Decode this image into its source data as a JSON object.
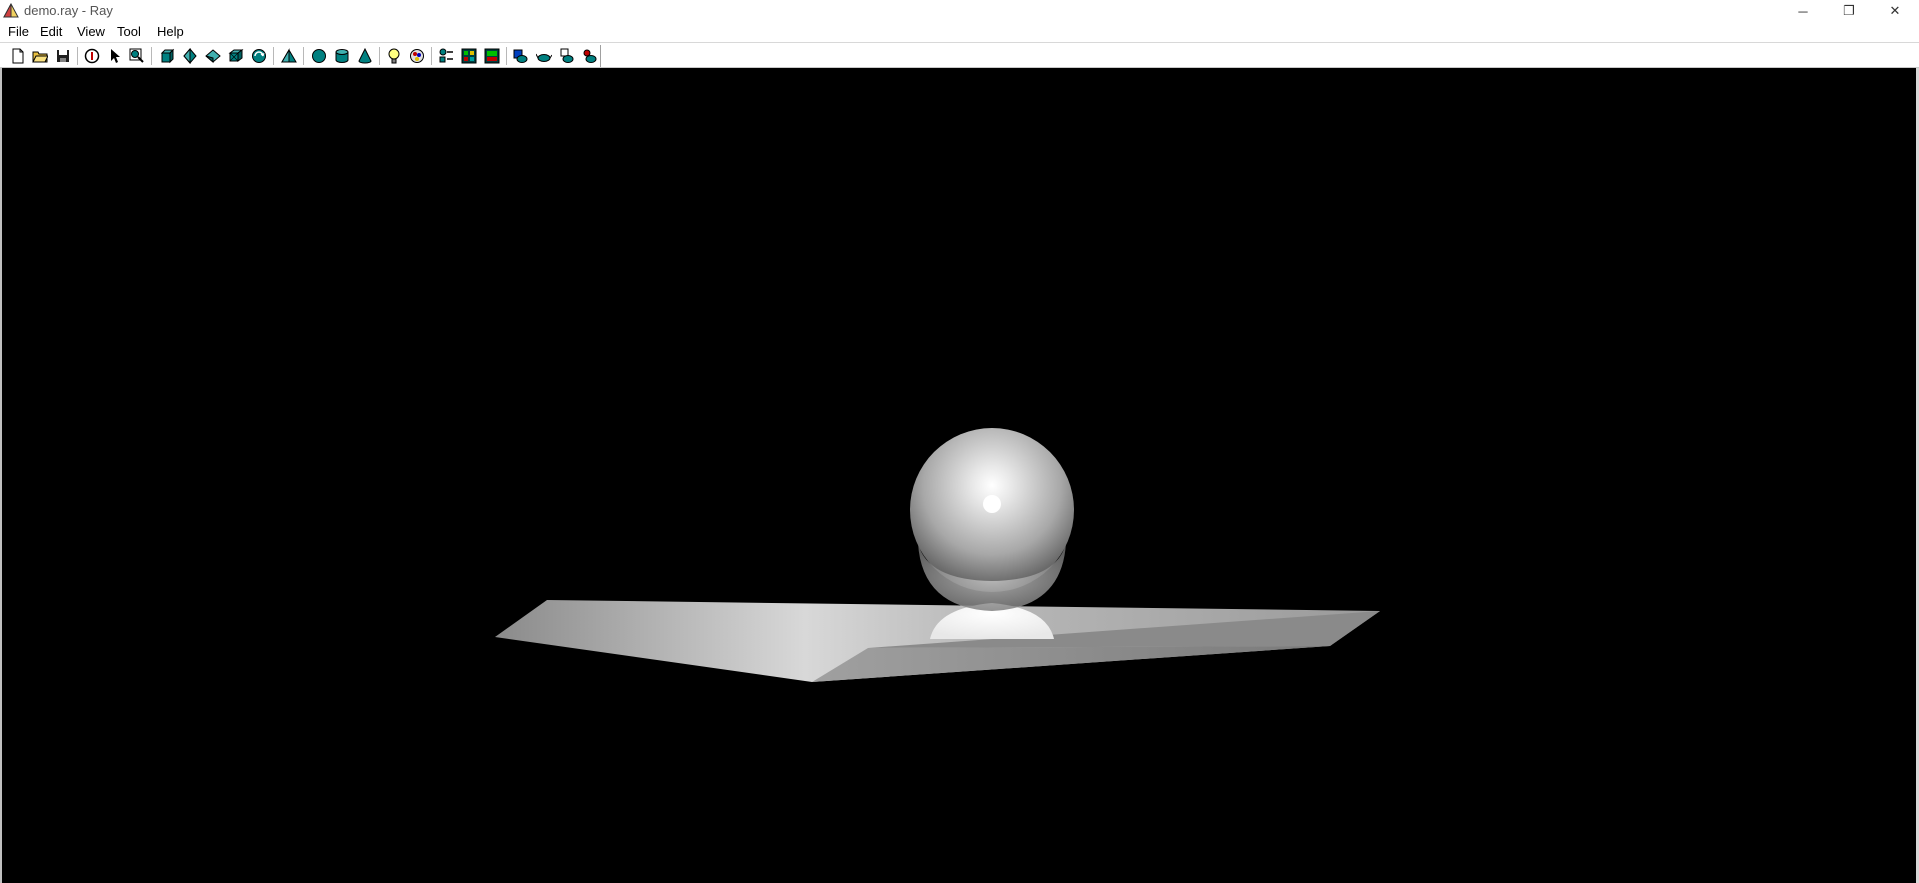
{
  "window": {
    "title": "demo.ray - Ray",
    "app_icon": "pyramid-icon",
    "controls": {
      "minimize": "─",
      "maximize": "❐",
      "close": "✕"
    }
  },
  "menu": {
    "items": [
      {
        "label": "File"
      },
      {
        "label": "Edit"
      },
      {
        "label": "View"
      },
      {
        "label": "Tool"
      },
      {
        "label": "Help"
      }
    ]
  },
  "toolbar": {
    "buttons": [
      {
        "icon": "new-file-icon"
      },
      {
        "icon": "open-folder-icon"
      },
      {
        "icon": "save-disk-icon"
      },
      {
        "icon": "info-icon"
      },
      {
        "icon": "select-arrow-icon"
      },
      {
        "icon": "zoom-icon"
      },
      {
        "icon": "view-front-icon"
      },
      {
        "icon": "view-side-icon"
      },
      {
        "icon": "view-top-icon"
      },
      {
        "icon": "view-perspective-icon"
      },
      {
        "icon": "view-rotate-icon"
      },
      {
        "icon": "add-plane-icon"
      },
      {
        "icon": "add-sphere-icon"
      },
      {
        "icon": "add-cylinder-icon"
      },
      {
        "icon": "add-cone-icon"
      },
      {
        "icon": "add-light-icon"
      },
      {
        "icon": "material-icon"
      },
      {
        "icon": "object-list-icon"
      },
      {
        "icon": "render-icon"
      },
      {
        "icon": "render-save-icon"
      },
      {
        "icon": "teapot-icon"
      },
      {
        "icon": "teapot-icon-2"
      },
      {
        "icon": "teapot-icon-3"
      },
      {
        "icon": "teapot-icon-4"
      }
    ]
  },
  "scene": {
    "background": "#000000",
    "objects": [
      "sphere",
      "box-plane"
    ]
  },
  "colors": {
    "teal_icon": "#008080",
    "viewport_bg": "#000000"
  }
}
